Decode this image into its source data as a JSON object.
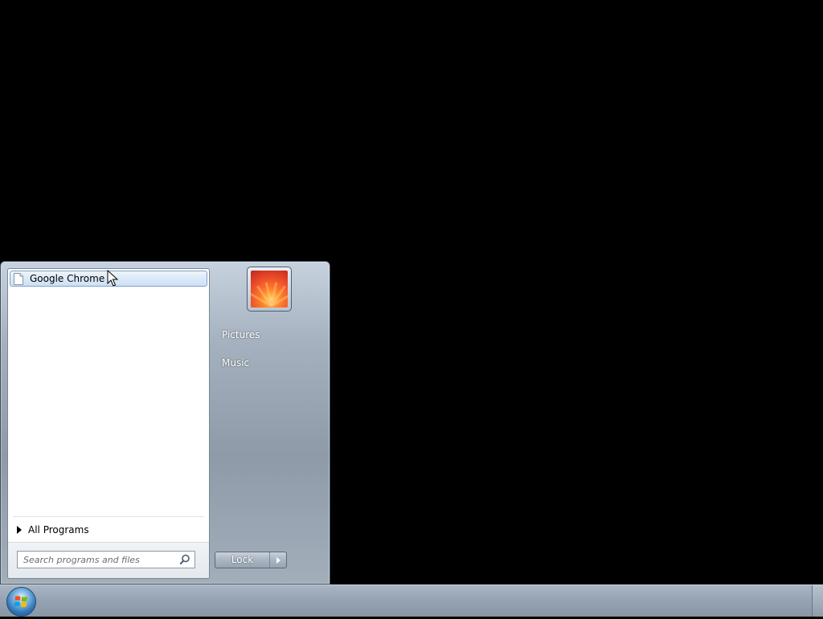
{
  "start_menu": {
    "programs": [
      {
        "label": "Google Chrome",
        "icon": "document-icon"
      }
    ],
    "all_programs_label": "All Programs",
    "search": {
      "placeholder": "Search programs and files",
      "value": ""
    },
    "right_links": [
      {
        "label": "Pictures"
      },
      {
        "label": "Music"
      }
    ],
    "lock_label": "Lock"
  },
  "colors": {
    "highlight_border": "#7da2ce",
    "highlight_fill": "#dce9f7",
    "desktop_background": "#000000"
  },
  "icons": {
    "start_orb": "windows-orb-icon",
    "search": "search-icon",
    "user": "user-picture-flower",
    "all_programs": "triangle-right-icon",
    "lock_options": "arrow-right-icon"
  }
}
